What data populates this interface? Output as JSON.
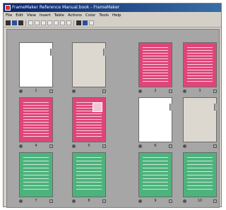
{
  "window": {
    "title": "FrameMaker Reference Manual.book - FrameMaker"
  },
  "menu": [
    "File",
    "Edit",
    "View",
    "Insert",
    "Table",
    "Actions",
    "Color",
    "Tools",
    "Help"
  ],
  "toolbar_icons": [
    "new-icon",
    "save-icon",
    "print-icon",
    "cut-icon",
    "copy-icon",
    "paste-icon",
    "undo-icon",
    "redo-icon",
    "zoom-icon",
    "navigate-icon",
    "help-icon"
  ],
  "pages": [
    {
      "label": "1",
      "color": "white"
    },
    {
      "label": "",
      "color": "beige"
    },
    {
      "label": "2",
      "color": "pink"
    },
    {
      "label": "3",
      "color": "pink"
    },
    {
      "label": "4",
      "color": "pink"
    },
    {
      "label": "5",
      "color": "pink"
    },
    {
      "label": "6",
      "color": "white"
    },
    {
      "label": "",
      "color": "beige"
    },
    {
      "label": "7",
      "color": "green"
    },
    {
      "label": "8",
      "color": "green"
    },
    {
      "label": "9",
      "color": "green"
    },
    {
      "label": "10",
      "color": "green"
    }
  ],
  "colors": {
    "pink": "#e0457a",
    "green": "#4db37c",
    "beige": "#dcd8d0",
    "white": "#ffffff",
    "background": "#a6a6a6"
  }
}
